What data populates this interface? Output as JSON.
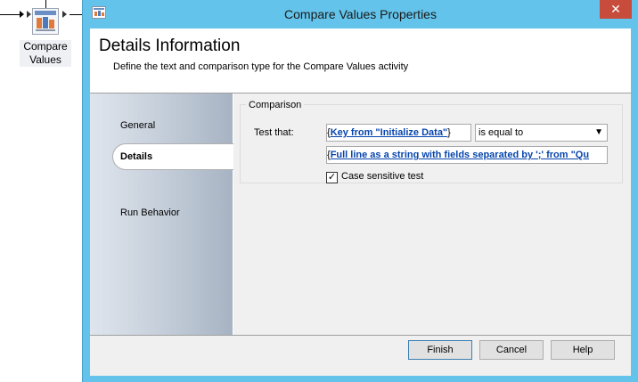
{
  "canvas": {
    "activity_label": "Compare Values"
  },
  "dialog": {
    "title": "Compare Values Properties",
    "close_glyph": "✕",
    "header": {
      "title": "Details Information",
      "subtitle": "Define the text and comparison type for the Compare Values activity"
    },
    "nav": {
      "items": [
        {
          "label": "General"
        },
        {
          "label": "Details"
        },
        {
          "label": "Run Behavior"
        }
      ],
      "selected": "Details"
    },
    "comparison": {
      "group_title": "Comparison",
      "test_label": "Test that:",
      "first_value": "Key from \"Initialize Data\"",
      "operator": "is equal to",
      "second_value": "Full line as a string with fields separated by ';' from \"Qu",
      "case_sensitive_label": "Case sensitive test",
      "case_sensitive_checked": true
    },
    "buttons": {
      "finish": "Finish",
      "cancel": "Cancel",
      "help": "Help"
    }
  },
  "colors": {
    "titlebar": "#63c3ea",
    "close_button": "#c74c3c",
    "link": "#0645ad"
  }
}
